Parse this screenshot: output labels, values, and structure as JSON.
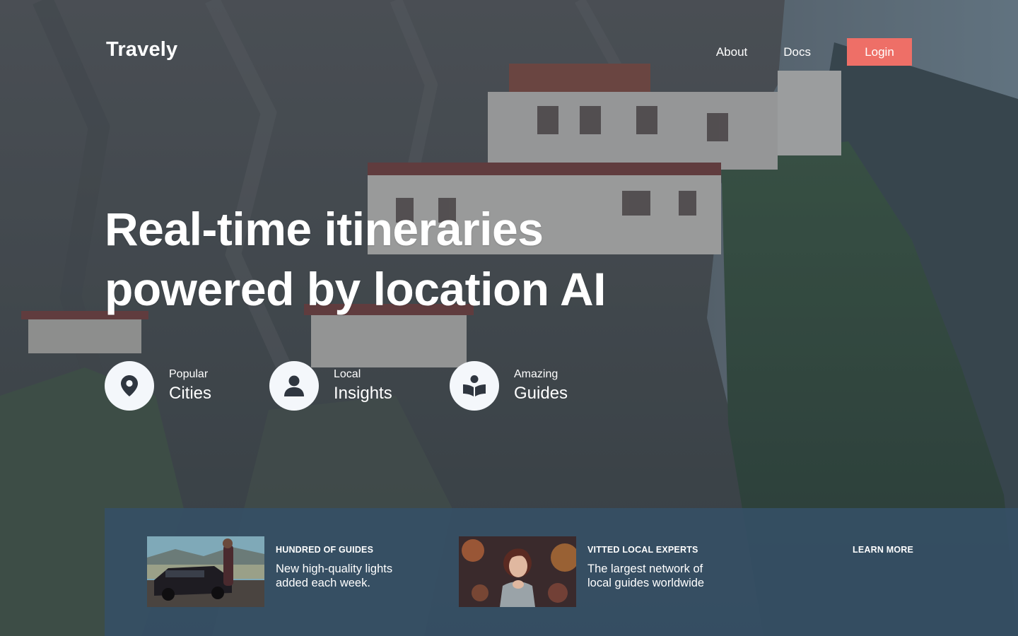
{
  "brand": {
    "name": "Travely"
  },
  "nav": {
    "about": "About",
    "docs": "Docs",
    "login": "Login"
  },
  "hero": {
    "headline_line1": "Real-time itineraries",
    "headline_line2": "powered by location AI"
  },
  "features": [
    {
      "small": "Popular",
      "big": "Cities",
      "icon": "map-pin-icon"
    },
    {
      "small": "Local",
      "big": "Insights",
      "icon": "user-icon"
    },
    {
      "small": "Amazing",
      "big": "Guides",
      "icon": "book-reader-icon"
    }
  ],
  "cards": [
    {
      "title": "HUNDRED OF GUIDES",
      "desc": "New  high-quality lights added each week."
    },
    {
      "title": "VITTED LOCAL EXPERTS",
      "desc": "The largest network of local guides worldwide"
    }
  ],
  "learn_more": "LEARN MORE",
  "colors": {
    "accent": "#ee6f67",
    "panel": "#365066",
    "icon_circle": "#f4f7fb",
    "icon": "#2f3640"
  }
}
